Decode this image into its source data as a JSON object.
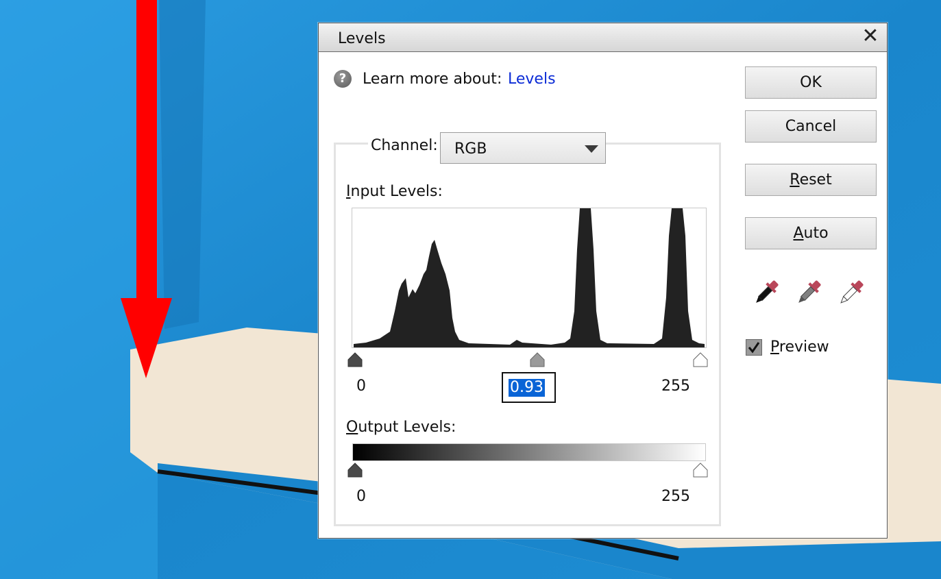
{
  "dialog": {
    "title": "Levels",
    "close_glyph": "✕",
    "help_glyph": "?",
    "learn_more_text": "Learn more about:",
    "learn_more_link": "Levels"
  },
  "channel": {
    "label": "Channel:",
    "value": "RGB"
  },
  "input_levels": {
    "label": "Input Levels:",
    "black": "0",
    "gamma": "0.93",
    "white": "255"
  },
  "output_levels": {
    "label": "Output Levels:",
    "black": "0",
    "white": "255"
  },
  "buttons": {
    "ok": "OK",
    "cancel": "Cancel",
    "reset": "Reset",
    "auto": "Auto"
  },
  "preview": {
    "label": "Preview",
    "checked": true
  },
  "icons": {
    "droppers": [
      "black-point-eyedropper-icon",
      "gray-point-eyedropper-icon",
      "white-point-eyedropper-icon"
    ],
    "arrow": "red-down-arrow"
  },
  "colors": {
    "wall_blue": "#1e8ed4",
    "ledge_cream": "#f2e6d4",
    "arrow_red": "#ff0000",
    "link_blue": "#0b2bd6",
    "selection_blue": "#0a64d6"
  }
}
